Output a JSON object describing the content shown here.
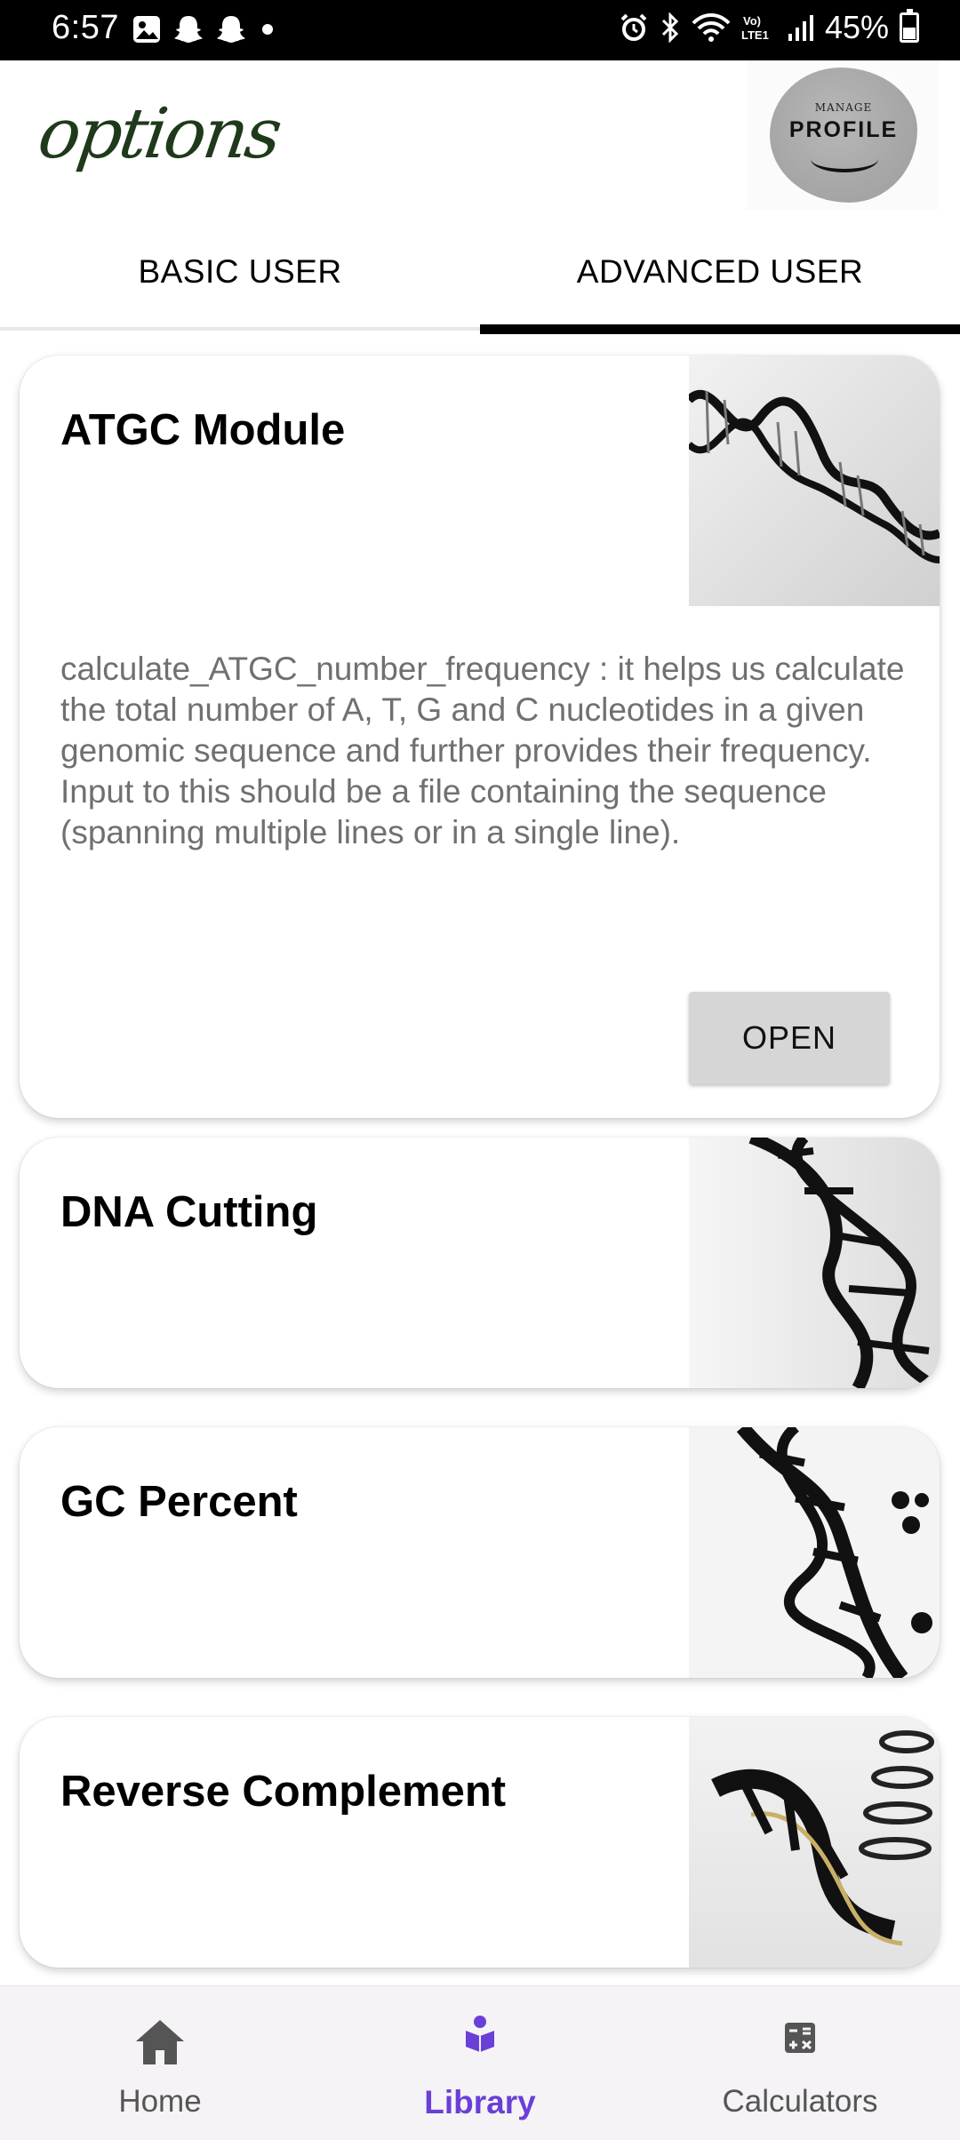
{
  "status_bar": {
    "time": "6:57",
    "battery_text": "45%",
    "battery_level": 0.45,
    "icons": [
      "gallery-icon",
      "snapchat-icon",
      "snapchat-icon",
      "dot-icon",
      "alarm-icon",
      "bluetooth-icon",
      "wifi-icon",
      "volte-icon",
      "signal-icon",
      "battery-icon"
    ]
  },
  "header": {
    "logo_text": "options",
    "profile_small": "MANAGE",
    "profile_big": "PROFILE"
  },
  "tabs": [
    {
      "label": "BASIC USER",
      "active": false
    },
    {
      "label": "ADVANCED USER",
      "active": true
    }
  ],
  "cards": [
    {
      "title": "ATGC Module",
      "description": "calculate_ATGC_number_frequency : it helps us calculate the total number of A, T, G and C nucleotides in a given genomic sequence and further provides their frequency. Input to this should be a file containing the sequence (spanning multiple lines or in a single line).",
      "button": "OPEN",
      "image": "dna-helix-image"
    },
    {
      "title": "DNA Cutting",
      "image": "dna-helix-image"
    },
    {
      "title": "GC Percent",
      "image": "dna-helix-image"
    },
    {
      "title": "Reverse Complement",
      "image": "dna-helix-image"
    }
  ],
  "bottom_nav": [
    {
      "label": "Home",
      "icon": "home-icon",
      "active": false
    },
    {
      "label": "Library",
      "icon": "library-icon",
      "active": true
    },
    {
      "label": "Calculators",
      "icon": "calculator-icon",
      "active": false
    }
  ],
  "colors": {
    "accent": "#6a3fd8",
    "tab_indicator": "#000000",
    "button_bg": "#d6d6d6",
    "description_text": "#707070"
  }
}
